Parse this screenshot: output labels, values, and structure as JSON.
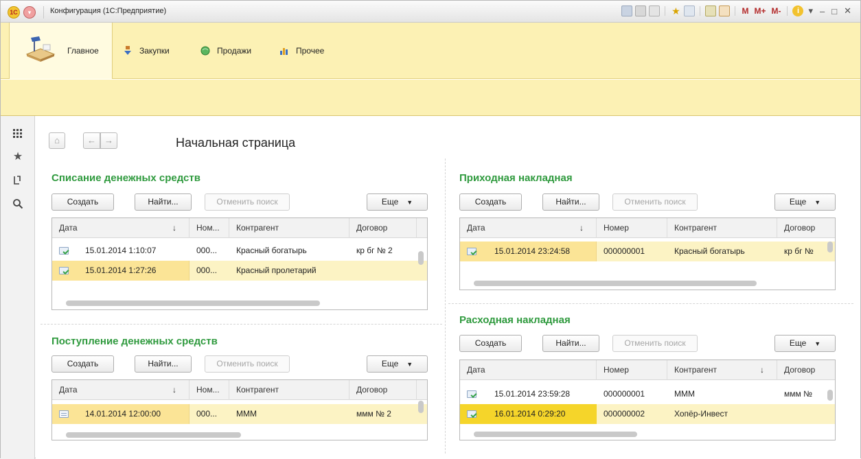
{
  "window": {
    "title": "Конфигурация  (1С:Предприятие)",
    "logo_text": "1C",
    "toolbar_m_labels": [
      "M",
      "M+",
      "M-"
    ]
  },
  "sections": {
    "items": [
      {
        "label": "Главное",
        "icon": "desk-lamp-icon"
      },
      {
        "label": "Закупки",
        "icon": "purchases-icon"
      },
      {
        "label": "Продажи",
        "icon": "sales-globe-icon"
      },
      {
        "label": "Прочее",
        "icon": "bar-chart-icon"
      }
    ]
  },
  "left_panel": {
    "icons": [
      "apps-grid-icon",
      "favorites-star-icon",
      "history-icon",
      "search-icon"
    ]
  },
  "page": {
    "title": "Начальная страница",
    "nav": {
      "home": "⌂",
      "back": "←",
      "forward": "→"
    }
  },
  "groups": {
    "writeoff": {
      "title": "Списание денежных средств",
      "buttons": {
        "create": "Создать",
        "find": "Найти...",
        "cancel_search": "Отменить поиск",
        "more": "Еще"
      },
      "columns": [
        "Дата",
        "Ном...",
        "Контрагент",
        "Договор"
      ],
      "rows": [
        {
          "date": "15.01.2014 1:10:07",
          "number": "000...",
          "counterparty": "Красный богатырь",
          "contract": "кр бг № 2"
        },
        {
          "date": "15.01.2014 1:27:26",
          "number": "000...",
          "counterparty": "Красный пролетарий",
          "contract": ""
        }
      ]
    },
    "receipt": {
      "title": "Поступление денежных средств",
      "buttons": {
        "create": "Создать",
        "find": "Найти...",
        "cancel_search": "Отменить поиск",
        "more": "Еще"
      },
      "columns": [
        "Дата",
        "Ном...",
        "Контрагент",
        "Договор"
      ],
      "rows": [
        {
          "date": "14.01.2014 12:00:00",
          "number": "000...",
          "counterparty": "МММ",
          "contract": "ммм № 2"
        }
      ]
    },
    "incoming": {
      "title": "Приходная накладная",
      "buttons": {
        "create": "Создать",
        "find": "Найти...",
        "cancel_search": "Отменить поиск",
        "more": "Еще"
      },
      "columns": [
        "Дата",
        "Номер",
        "Контрагент",
        "Договор"
      ],
      "rows": [
        {
          "date": "15.01.2014 23:24:58",
          "number": "000000001",
          "counterparty": "Красный богатырь",
          "contract": "кр бг №"
        }
      ]
    },
    "outgoing": {
      "title": "Расходная накладная",
      "buttons": {
        "create": "Создать",
        "find": "Найти...",
        "cancel_search": "Отменить поиск",
        "more": "Еще"
      },
      "columns": [
        "Дата",
        "Номер",
        "Контрагент",
        "Договор"
      ],
      "rows": [
        {
          "date": "15.01.2014 23:59:28",
          "number": "000000001",
          "counterparty": "МММ",
          "contract": "ммм №"
        },
        {
          "date": "16.01.2014 0:29:20",
          "number": "000000002",
          "counterparty": "Хопёр-Инвест",
          "contract": ""
        }
      ]
    }
  },
  "colors": {
    "accent_green": "#2f9a3e",
    "section_bar": "#fcf1b4",
    "selected_row": "#fcf3c4"
  }
}
